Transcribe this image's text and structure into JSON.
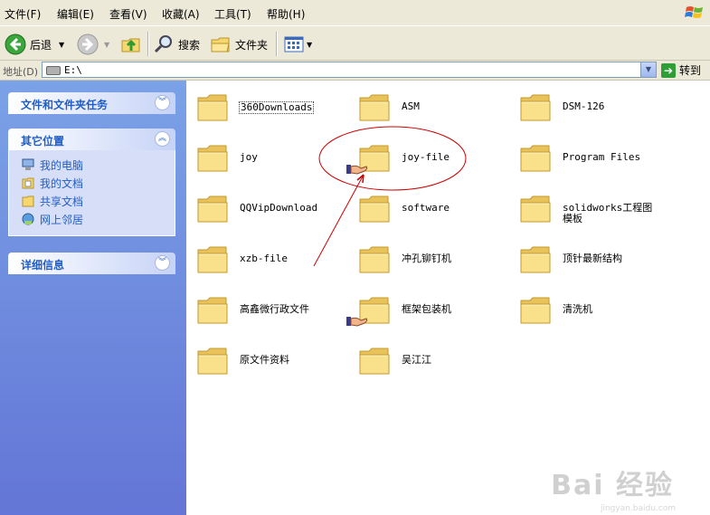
{
  "menu": [
    "文件(F)",
    "编辑(E)",
    "查看(V)",
    "收藏(A)",
    "工具(T)",
    "帮助(H)"
  ],
  "toolbar": {
    "back": "后退",
    "search": "搜索",
    "folders": "文件夹"
  },
  "address": {
    "label": "地址(D)",
    "path": "E:\\",
    "go": "转到"
  },
  "taskpane": {
    "tasks_title": "文件和文件夹任务",
    "other_title": "其它位置",
    "places": [
      {
        "label": "我的电脑",
        "icon": "computer-icon"
      },
      {
        "label": "我的文档",
        "icon": "documents-icon"
      },
      {
        "label": "共享文档",
        "icon": "shared-folder-icon"
      },
      {
        "label": "网上邻居",
        "icon": "network-icon"
      }
    ],
    "details_title": "详细信息"
  },
  "folders": [
    {
      "name": "360Downloads",
      "shared": false
    },
    {
      "name": "ASM",
      "shared": false
    },
    {
      "name": "DSM-126",
      "shared": false
    },
    {
      "name": "joy",
      "shared": false
    },
    {
      "name": "joy-file",
      "shared": true
    },
    {
      "name": "Program Files",
      "shared": false
    },
    {
      "name": "QQVipDownload",
      "shared": false
    },
    {
      "name": "software",
      "shared": false
    },
    {
      "name": "solidworks工程图模板",
      "shared": false
    },
    {
      "name": "xzb-file",
      "shared": false
    },
    {
      "name": "冲孔铆钉机",
      "shared": false
    },
    {
      "name": "顶针最新结构",
      "shared": false
    },
    {
      "name": "高鑫微行政文件",
      "shared": false
    },
    {
      "name": "框架包装机",
      "shared": true
    },
    {
      "name": "清洗机",
      "shared": false
    },
    {
      "name": "原文件资料",
      "shared": false
    },
    {
      "name": "吴江江",
      "shared": false
    }
  ],
  "watermark": {
    "main": "Bai 经验",
    "sub": "jingyan.baidu.com"
  },
  "colors": {
    "accent": "#215dc6",
    "annotation": "#cc0000",
    "folder": "#f5d76e"
  }
}
